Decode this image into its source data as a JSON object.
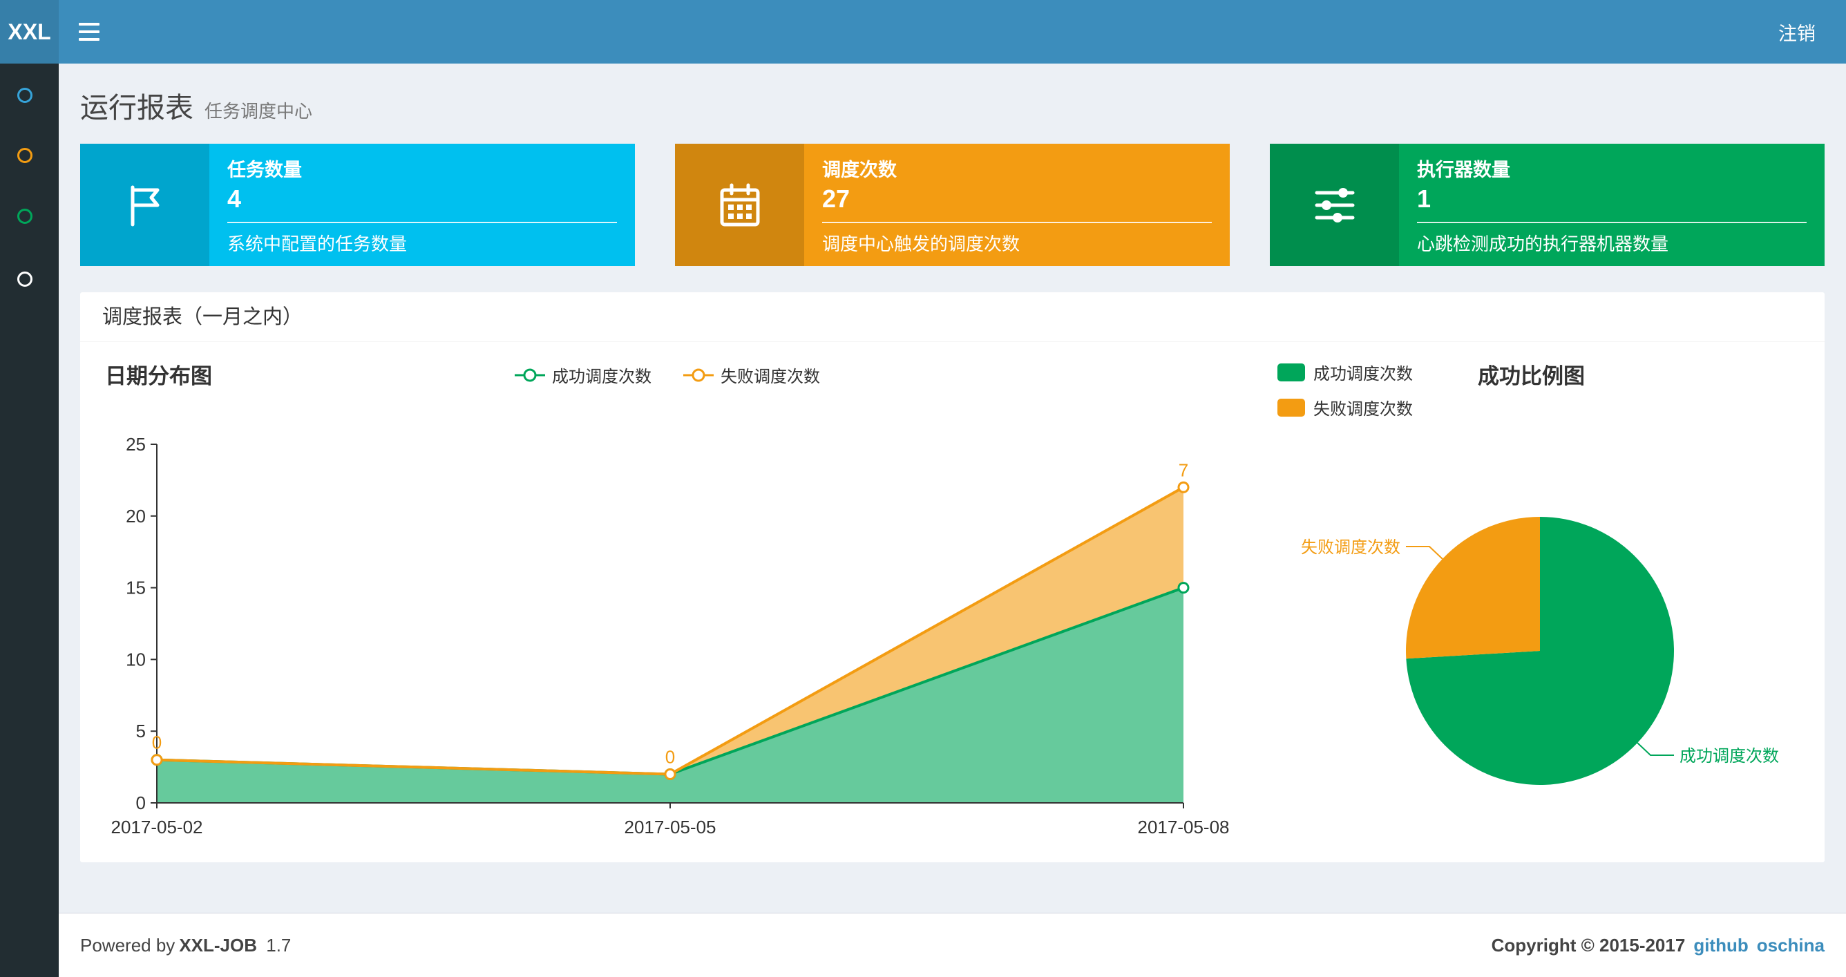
{
  "navbar": {
    "logo": "XXL",
    "logout_label": "注销"
  },
  "sidebar": {
    "items": [
      {
        "name": "menu-item-1",
        "color": "#36a3d9"
      },
      {
        "name": "menu-item-2",
        "color": "#f39c12"
      },
      {
        "name": "menu-item-3",
        "color": "#00a65a"
      },
      {
        "name": "menu-item-4",
        "color": "#ffffff"
      }
    ]
  },
  "page": {
    "title": "运行报表",
    "subtitle": "任务调度中心"
  },
  "cards": [
    {
      "icon": "flag-icon",
      "label": "任务数量",
      "value": "4",
      "description": "系统中配置的任务数量",
      "color": "#00c0ef"
    },
    {
      "icon": "calendar-icon",
      "label": "调度次数",
      "value": "27",
      "description": "调度中心触发的调度次数",
      "color": "#f39c12"
    },
    {
      "icon": "sliders-icon",
      "label": "执行器数量",
      "value": "1",
      "description": "心跳检测成功的执行器机器数量",
      "color": "#00a65a"
    }
  ],
  "panel": {
    "title": "调度报表（一月之内）"
  },
  "chart_data": [
    {
      "type": "area",
      "title": "日期分布图",
      "categories": [
        "2017-05-02",
        "2017-05-05",
        "2017-05-08"
      ],
      "stacked": true,
      "series": [
        {
          "name": "成功调度次数",
          "color": "#00a65a",
          "values": [
            3,
            2,
            15
          ]
        },
        {
          "name": "失败调度次数",
          "color": "#f39c12",
          "values": [
            0,
            0,
            7
          ],
          "labels": [
            "0",
            "0",
            "7"
          ]
        }
      ],
      "ylim": [
        0,
        25
      ],
      "ytick_step": 5,
      "grid": false,
      "legend_position": "top-center"
    },
    {
      "type": "pie",
      "title": "成功比例图",
      "series": [
        {
          "name": "成功调度次数",
          "color": "#00a65a",
          "value": 20
        },
        {
          "name": "失败调度次数",
          "color": "#f39c12",
          "value": 7
        }
      ],
      "legend_position": "top-left"
    }
  ],
  "footer": {
    "powered_prefix": "Powered by",
    "product": "XXL-JOB",
    "version": "1.7",
    "copyright": "Copyright © 2015-2017",
    "links": [
      {
        "label": "github"
      },
      {
        "label": "oschina"
      }
    ]
  }
}
